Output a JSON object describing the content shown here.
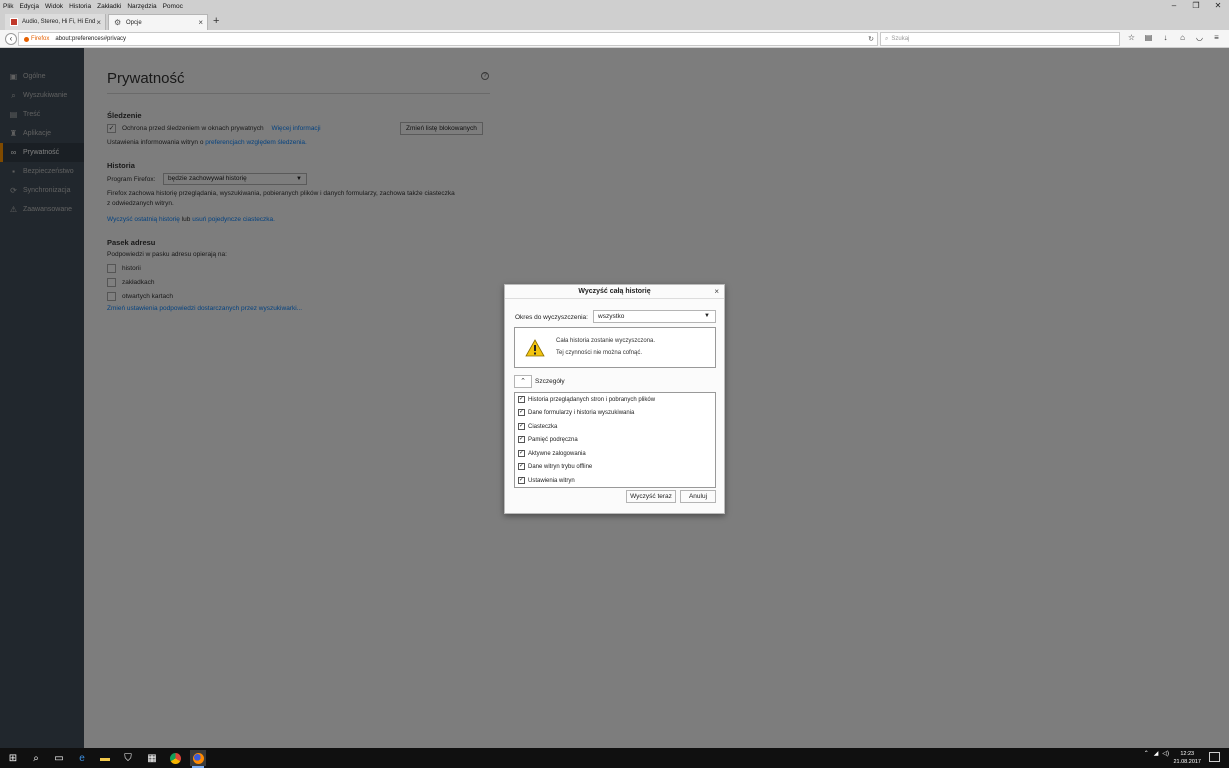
{
  "menubar": [
    "Plik",
    "Edycja",
    "Widok",
    "Historia",
    "Zakładki",
    "Narzędzia",
    "Pomoc"
  ],
  "window_controls": {
    "minimize": "–",
    "restore": "❐",
    "close": "✕"
  },
  "tabs": [
    {
      "title": "Audio, Stereo, Hi Fi, Hi End"
    },
    {
      "title": "Opcje"
    }
  ],
  "navbar": {
    "identity": "Firefox",
    "url": "about:preferences#privacy",
    "search_placeholder": "Szukaj"
  },
  "sidebar": [
    {
      "label": "Ogólne",
      "icon": "general-icon"
    },
    {
      "label": "Wyszukiwanie",
      "icon": "search-icon"
    },
    {
      "label": "Treść",
      "icon": "content-icon"
    },
    {
      "label": "Aplikacje",
      "icon": "applications-icon"
    },
    {
      "label": "Prywatność",
      "icon": "privacy-mask-icon"
    },
    {
      "label": "Bezpieczeństwo",
      "icon": "lock-icon"
    },
    {
      "label": "Synchronizacja",
      "icon": "sync-icon"
    },
    {
      "label": "Zaawansowane",
      "icon": "advanced-icon"
    }
  ],
  "main": {
    "title": "Prywatność",
    "tracking": {
      "heading": "Śledzenie",
      "checkbox_label": "Ochrona przed śledzeniem w oknach prywatnych",
      "more_info": "Więcej informacji",
      "change_block": "Zmień listę blokowanych",
      "dnt_prefix": "Ustawienia informowania witryn o",
      "dnt_link": "preferencjach względem śledzenia."
    },
    "history": {
      "heading": "Historia",
      "program_label": "Program Firefox:",
      "mode": "będzie zachowywał historię",
      "description_1": "Firefox zachowa historię przeglądania, wyszukiwania, pobieranych plików i danych formularzy, zachowa także ciasteczka",
      "description_2": "z odwiedzanych witryn.",
      "clear_link": "Wyczyść ostatnią historię",
      "or_text": "lub",
      "remove_cookies_link": "usuń pojedyncze ciasteczka."
    },
    "location_bar": {
      "heading": "Pasek adresu",
      "description": "Podpowiedzi w pasku adresu opierają na:",
      "options": [
        "historii",
        "zakładkach",
        "otwartych kartach"
      ],
      "change_link": "Zmień ustawienia podpowiedzi dostarczanych przez wyszukiwarki..."
    }
  },
  "dialog": {
    "title": "Wyczyść całą historię",
    "range_label": "Okres do wyczyszczenia:",
    "range_value": "wszystko",
    "warning_line1": "Cała historia zostanie wyczyszczona.",
    "warning_line2": "Tej czynności nie można cofnąć.",
    "details_label": "Szczegóły",
    "items": [
      "Historia przeglądanych stron i pobranych plików",
      "Dane formularzy i historia wyszukiwania",
      "Ciasteczka",
      "Pamięć podręczna",
      "Aktywne zalogowania",
      "Dane witryn trybu offline",
      "Ustawienia witryn"
    ],
    "clear_now": "Wyczyść teraz",
    "cancel": "Anuluj"
  },
  "taskbar": {
    "time": "12:23",
    "date": "21.08.2017"
  }
}
